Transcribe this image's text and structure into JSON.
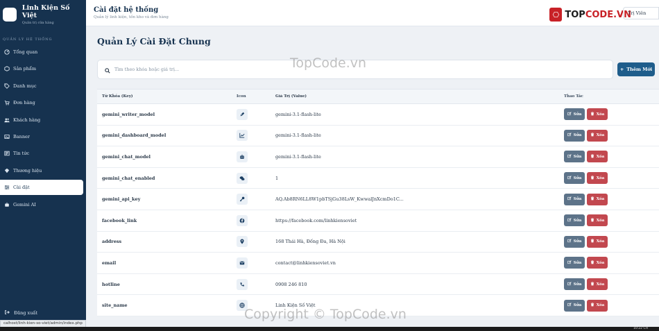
{
  "brand": {
    "name": "Linh Kiện Số Việt",
    "subtitle": "Quản trị cửa hàng"
  },
  "sidebar": {
    "section_label": "QUẢN LÝ HỆ THỐNG",
    "items": [
      {
        "label": "Tổng quan",
        "icon": "gauge-icon"
      },
      {
        "label": "Sản phẩm",
        "icon": "box-icon"
      },
      {
        "label": "Danh mục",
        "icon": "tag-icon"
      },
      {
        "label": "Đơn hàng",
        "icon": "cart-icon"
      },
      {
        "label": "Khách hàng",
        "icon": "users-icon"
      },
      {
        "label": "Banner",
        "icon": "image-icon"
      },
      {
        "label": "Tin tức",
        "icon": "news-icon"
      },
      {
        "label": "Thương hiệu",
        "icon": "brand-icon"
      },
      {
        "label": "Cài đặt",
        "icon": "sliders-icon",
        "active": true
      },
      {
        "label": "Gemini AI",
        "icon": "robot-icon"
      }
    ],
    "logout_label": "Đăng xuất"
  },
  "header": {
    "title": "Cài đặt hệ thống",
    "subtitle": "Quản lý linh kiện, tồn kho và đơn hàng",
    "user_label": "Trị Viên"
  },
  "watermark": {
    "logo_a": "TOP",
    "logo_b": "CODE.VN",
    "center": "TopCode.vn",
    "bottom": "Copyright © TopCode.vn"
  },
  "main": {
    "page_title": "Quản Lý Cài Đặt Chung",
    "search_placeholder": "Tìm theo khóa hoặc giá trị...",
    "add_button": "Thêm Mới",
    "columns": {
      "key": "Từ Khóa (Key)",
      "icon": "Icon",
      "value": "Giá Trị (Value)",
      "actions": "Thao Tác"
    },
    "edit_label": "Sửa",
    "delete_label": "Xóa",
    "rows": [
      {
        "key": "gemini_writer_model",
        "icon": "pen-icon",
        "value": "gemini-3.1-flash-lite"
      },
      {
        "key": "gemini_dashboard_model",
        "icon": "chart-line-icon",
        "value": "gemini-3.1-flash-lite"
      },
      {
        "key": "gemini_chat_model",
        "icon": "robot-icon",
        "value": "gemini-3.1-flash-lite"
      },
      {
        "key": "gemini_chat_enabled",
        "icon": "chat-icon",
        "value": "1"
      },
      {
        "key": "gemini_api_key",
        "icon": "key-icon",
        "value": "AQ.Ab8RN6LL8W1pbTSjGu38LsW_KwwalJnXcmDo1C..."
      },
      {
        "key": "facebook_link",
        "icon": "facebook-icon",
        "value": "https://facebook.com/linhkiensoviet"
      },
      {
        "key": "address",
        "icon": "map-pin-icon",
        "value": "168 Thái Hà, Đống Đa, Hà Nội"
      },
      {
        "key": "email",
        "icon": "envelope-icon",
        "value": "contact@linhkiensoviet.vn"
      },
      {
        "key": "hotline",
        "icon": "phone-icon",
        "value": "0908 246 810"
      },
      {
        "key": "site_name",
        "icon": "globe-icon",
        "value": "Linh Kiện Số Việt"
      }
    ]
  },
  "status_bar": {
    "url": "calhost/linh-kien-so-viet/admin/index.php"
  },
  "taskbar": {
    "clock": "10:22 CH"
  }
}
